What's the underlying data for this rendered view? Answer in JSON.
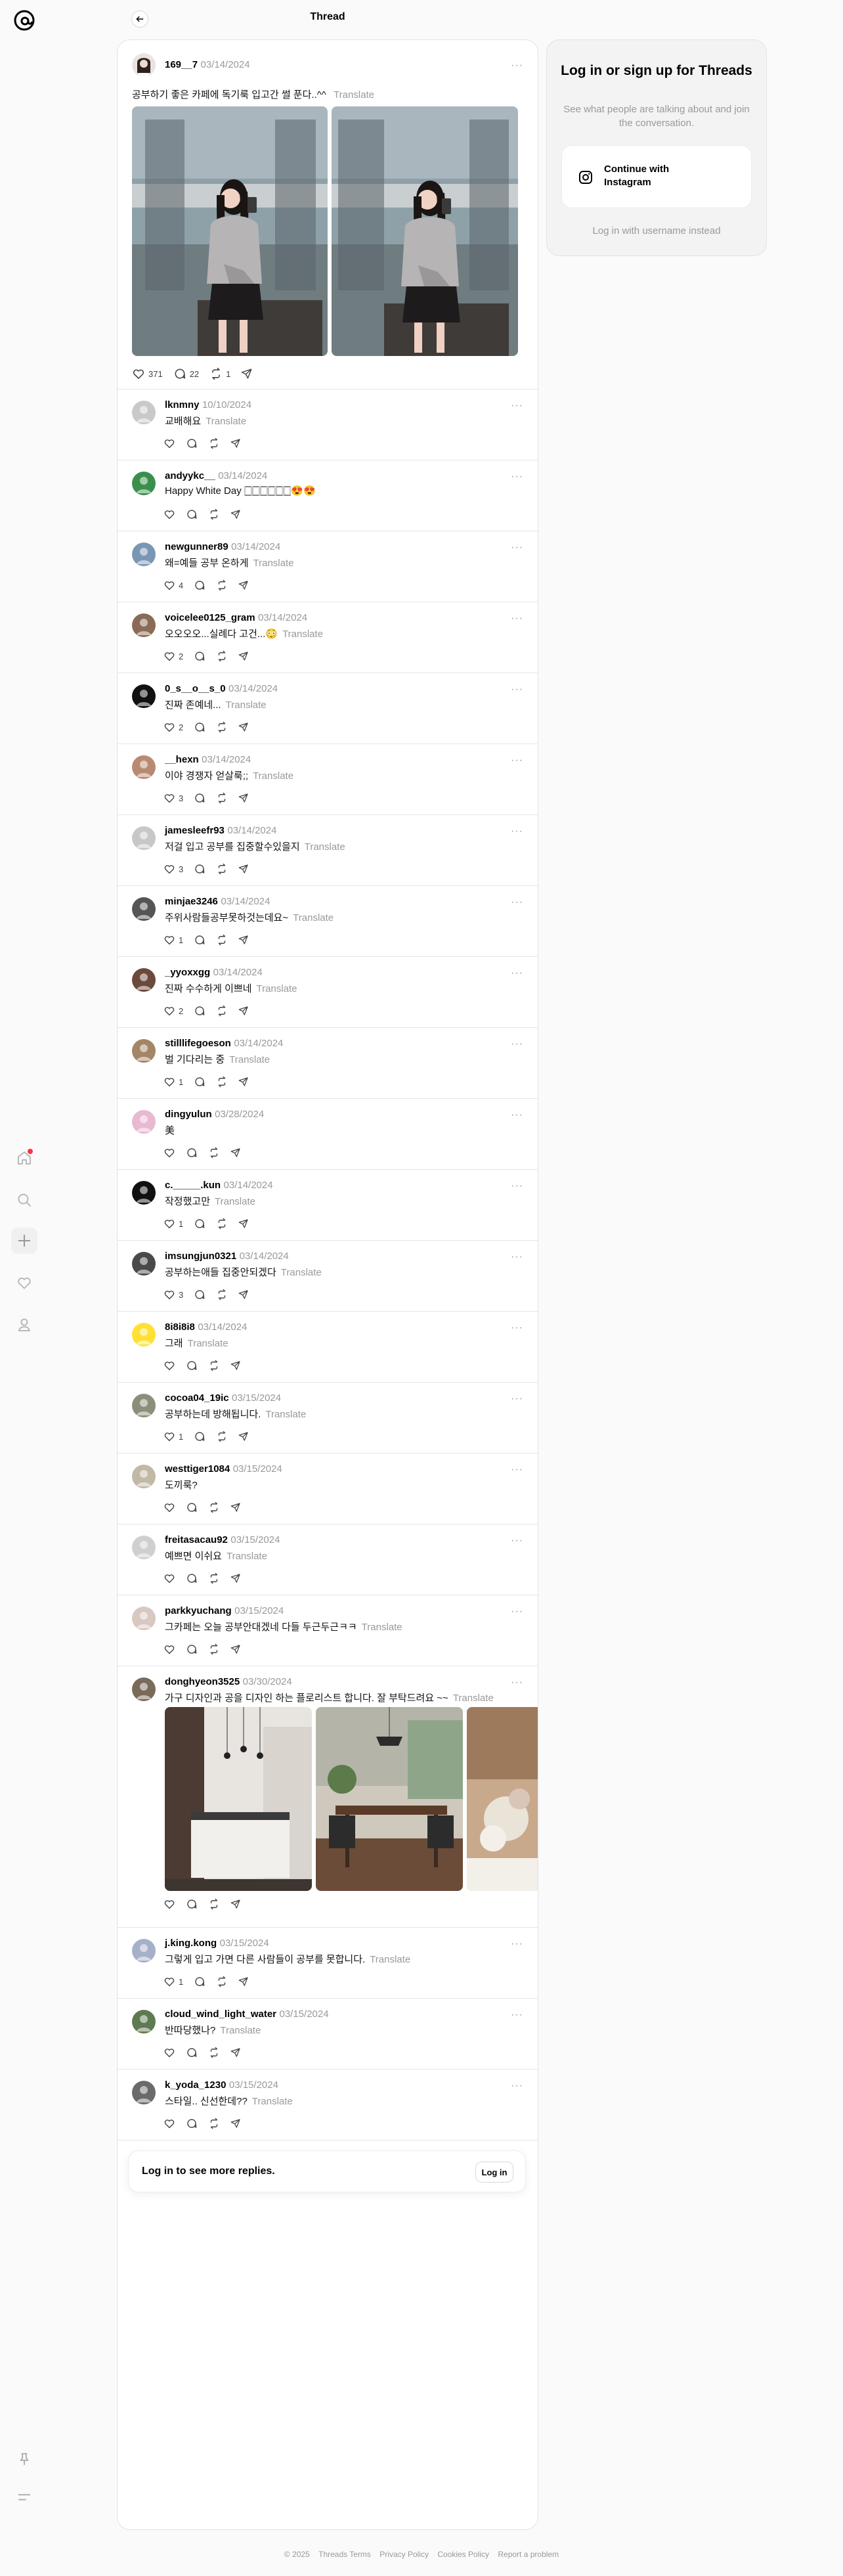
{
  "header": {
    "title": "Thread"
  },
  "main_post": {
    "username": "169__7",
    "date": "03/14/2024",
    "text": "공부하기 좋은 카페에 독기룩 입고간 썰 푼다..^^",
    "translate": "Translate",
    "likes": "371",
    "comments": "22",
    "reposts": "1"
  },
  "replies": [
    {
      "username": "lknmny",
      "date": "10/10/2024",
      "text": "교배해요",
      "translate": "Translate",
      "likes": ""
    },
    {
      "username": "andyykc__",
      "date": "03/14/2024",
      "text": "Happy White Day 🀆🀆🀆🀆🀆🀆😍😍",
      "translate": "",
      "likes": ""
    },
    {
      "username": "newgunner89",
      "date": "03/14/2024",
      "text": "왜=예들 공부 온하게",
      "translate": "Translate",
      "likes": "4"
    },
    {
      "username": "voicelee0125_gram",
      "date": "03/14/2024",
      "text": "오오오오...실례다 고건...😳",
      "translate": "Translate",
      "likes": "2"
    },
    {
      "username": "0_s__o__s_0",
      "date": "03/14/2024",
      "text": "진짜 존예네...",
      "translate": "Translate",
      "likes": "2"
    },
    {
      "username": "__hexn",
      "date": "03/14/2024",
      "text": "이야 경쟁자 얻살룩;;",
      "translate": "Translate",
      "likes": "3"
    },
    {
      "username": "jamesleefr93",
      "date": "03/14/2024",
      "text": "저걸 입고 공부를 집중할수있을지",
      "translate": "Translate",
      "likes": "3"
    },
    {
      "username": "minjae3246",
      "date": "03/14/2024",
      "text": "주위사람들공부못하것는데요~",
      "translate": "Translate",
      "likes": "1"
    },
    {
      "username": "_yyoxxgg",
      "date": "03/14/2024",
      "text": "진짜 수수하게 이쁘네",
      "translate": "Translate",
      "likes": "2"
    },
    {
      "username": "stilllifegoeson",
      "date": "03/14/2024",
      "text": "벌 기다리는 중",
      "translate": "Translate",
      "likes": "1"
    },
    {
      "username": "dingyulun",
      "date": "03/28/2024",
      "text": "美",
      "translate": "",
      "likes": ""
    },
    {
      "username": "c._____.kun",
      "date": "03/14/2024",
      "text": "작정했고만",
      "translate": "Translate",
      "likes": "1"
    },
    {
      "username": "imsungjun0321",
      "date": "03/14/2024",
      "text": "공부하는애들 집중안되겠다",
      "translate": "Translate",
      "likes": "3"
    },
    {
      "username": "8i8i8i8",
      "date": "03/14/2024",
      "text": "그래",
      "translate": "Translate",
      "likes": ""
    },
    {
      "username": "cocoa04_19ic",
      "date": "03/15/2024",
      "text": "공부하는데 방해됩니다.",
      "translate": "Translate",
      "likes": "1"
    },
    {
      "username": "westtiger1084",
      "date": "03/15/2024",
      "text": "도끼룩?",
      "translate": "",
      "likes": ""
    },
    {
      "username": "freitasacau92",
      "date": "03/15/2024",
      "text": "예쁘면 이쉬요",
      "translate": "Translate",
      "likes": ""
    },
    {
      "username": "parkkyuchang",
      "date": "03/15/2024",
      "text": "그카페는 오늘 공부안대겠네 다들 두근두근ㅋㅋ",
      "translate": "Translate",
      "likes": ""
    },
    {
      "username": "donghyeon3525",
      "date": "03/30/2024",
      "text": "가구 디자인과 공을 디자인 하는 플로리스트 합니다. 잘 부탁드려요 ~~",
      "translate": "Translate",
      "likes": ""
    },
    {
      "username": "j.king.kong",
      "date": "03/15/2024",
      "text": "그렇게 입고 가면 다른 사람들이 공부를 못합니다.",
      "translate": "Translate",
      "likes": "1"
    },
    {
      "username": "cloud_wind_light_water",
      "date": "03/15/2024",
      "text": "반따당했나?",
      "translate": "Translate",
      "likes": ""
    },
    {
      "username": "k_yoda_1230",
      "date": "03/15/2024",
      "text": "스타일.. 신선한데??",
      "translate": "Translate",
      "likes": ""
    }
  ],
  "login_bar": {
    "text": "Log in to see more replies.",
    "button": "Log in"
  },
  "sidebar": {
    "title": "Log in or sign up for Threads",
    "subtitle": "See what people are talking about and join the conversation.",
    "instagram_button": "Continue with Instagram",
    "username_login": "Log in with username instead"
  },
  "footer": {
    "copyright": "© 2025",
    "links": [
      "Threads Terms",
      "Privacy Policy",
      "Cookies Policy",
      "Report a problem"
    ]
  },
  "colors": {
    "notification_dot": "#ff3040",
    "muted": "#999999"
  },
  "icons": [
    "threads-logo-icon",
    "home-icon",
    "search-icon",
    "plus-icon",
    "heart-icon",
    "profile-icon",
    "pin-icon",
    "menu-icon",
    "back-arrow-icon",
    "like-icon",
    "comment-icon",
    "repost-icon",
    "share-icon",
    "instagram-icon",
    "more-icon"
  ]
}
